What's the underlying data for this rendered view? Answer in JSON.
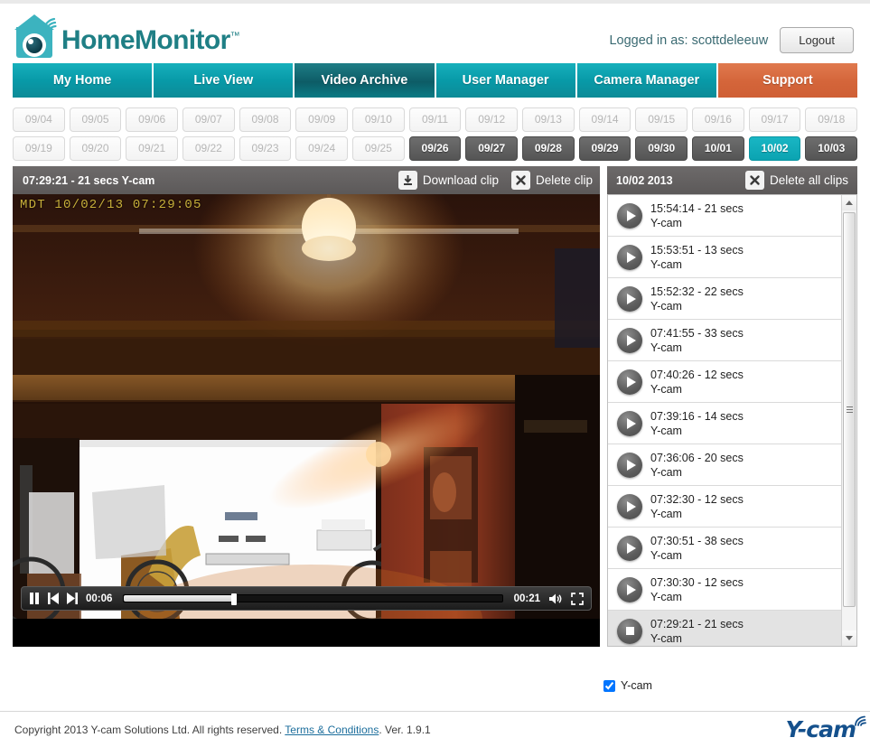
{
  "header": {
    "logo_text": "HomeMonitor",
    "logo_tm": "™",
    "logged_in_label": "Logged in as: scottdeleeuw",
    "logout_label": "Logout"
  },
  "nav": {
    "items": [
      {
        "label": "My Home",
        "state": "normal"
      },
      {
        "label": "Live View",
        "state": "normal"
      },
      {
        "label": "Video Archive",
        "state": "active"
      },
      {
        "label": "User Manager",
        "state": "normal"
      },
      {
        "label": "Camera Manager",
        "state": "normal"
      },
      {
        "label": "Support",
        "state": "support"
      }
    ]
  },
  "date_tabs": {
    "row1": [
      {
        "label": "09/04",
        "state": "empty"
      },
      {
        "label": "09/05",
        "state": "empty"
      },
      {
        "label": "09/06",
        "state": "empty"
      },
      {
        "label": "09/07",
        "state": "empty"
      },
      {
        "label": "09/08",
        "state": "empty"
      },
      {
        "label": "09/09",
        "state": "empty"
      },
      {
        "label": "09/10",
        "state": "empty"
      },
      {
        "label": "09/11",
        "state": "empty"
      },
      {
        "label": "09/12",
        "state": "empty"
      },
      {
        "label": "09/13",
        "state": "empty"
      },
      {
        "label": "09/14",
        "state": "empty"
      },
      {
        "label": "09/15",
        "state": "empty"
      },
      {
        "label": "09/16",
        "state": "empty"
      },
      {
        "label": "09/17",
        "state": "empty"
      },
      {
        "label": "09/18",
        "state": "empty"
      }
    ],
    "row2": [
      {
        "label": "09/19",
        "state": "empty"
      },
      {
        "label": "09/20",
        "state": "empty"
      },
      {
        "label": "09/21",
        "state": "empty"
      },
      {
        "label": "09/22",
        "state": "empty"
      },
      {
        "label": "09/23",
        "state": "empty"
      },
      {
        "label": "09/24",
        "state": "empty"
      },
      {
        "label": "09/25",
        "state": "empty"
      },
      {
        "label": "09/26",
        "state": "available"
      },
      {
        "label": "09/27",
        "state": "available"
      },
      {
        "label": "09/28",
        "state": "available"
      },
      {
        "label": "09/29",
        "state": "available"
      },
      {
        "label": "09/30",
        "state": "available"
      },
      {
        "label": "10/01",
        "state": "available"
      },
      {
        "label": "10/02",
        "state": "selected"
      },
      {
        "label": "10/03",
        "state": "available"
      }
    ]
  },
  "video": {
    "title": "07:29:21 - 21 secs  Y-cam",
    "download_label": "Download clip",
    "download_icon": "download-icon",
    "delete_label": "Delete clip",
    "delete_icon": "x-icon",
    "overlay_timestamp": "MDT 10/02/13 07:29:05",
    "controls": {
      "pause_icon": "pause-icon",
      "prev_icon": "previous-icon",
      "next_icon": "next-icon",
      "current_time": "00:06",
      "total_time": "00:21",
      "progress_percent": 29,
      "volume_icon": "volume-icon",
      "fullscreen_icon": "fullscreen-icon"
    }
  },
  "clips": {
    "panel_date": "10/02 2013",
    "delete_all_label": "Delete all clips",
    "delete_all_icon": "x-icon",
    "items": [
      {
        "time": "15:54:14 - 21 secs",
        "camera": "Y-cam",
        "state": "idle"
      },
      {
        "time": "15:53:51 - 13 secs",
        "camera": "Y-cam",
        "state": "idle"
      },
      {
        "time": "15:52:32 - 22 secs",
        "camera": "Y-cam",
        "state": "idle"
      },
      {
        "time": "07:41:55 - 33 secs",
        "camera": "Y-cam",
        "state": "idle"
      },
      {
        "time": "07:40:26 - 12 secs",
        "camera": "Y-cam",
        "state": "idle"
      },
      {
        "time": "07:39:16 - 14 secs",
        "camera": "Y-cam",
        "state": "idle"
      },
      {
        "time": "07:36:06 - 20 secs",
        "camera": "Y-cam",
        "state": "idle"
      },
      {
        "time": "07:32:30 - 12 secs",
        "camera": "Y-cam",
        "state": "idle"
      },
      {
        "time": "07:30:51 - 38 secs",
        "camera": "Y-cam",
        "state": "idle"
      },
      {
        "time": "07:30:30 - 12 secs",
        "camera": "Y-cam",
        "state": "idle"
      },
      {
        "time": "07:29:21 - 21 secs",
        "camera": "Y-cam",
        "state": "playing"
      }
    ]
  },
  "cam_filter": {
    "label": "Y-cam",
    "checked": true
  },
  "footer": {
    "copyright_prefix": "Copyright 2013 Y-cam Solutions Ltd. All rights reserved. ",
    "terms_label": "Terms & Conditions",
    "version_suffix": ". Ver. 1.9.1",
    "brand": "Y-cam"
  },
  "colors": {
    "teal": "#0ba3b1",
    "teal_dark": "#0d5c66",
    "orange": "#d4653a",
    "gray_bar": "#5c5959",
    "brand_blue": "#14508c"
  }
}
